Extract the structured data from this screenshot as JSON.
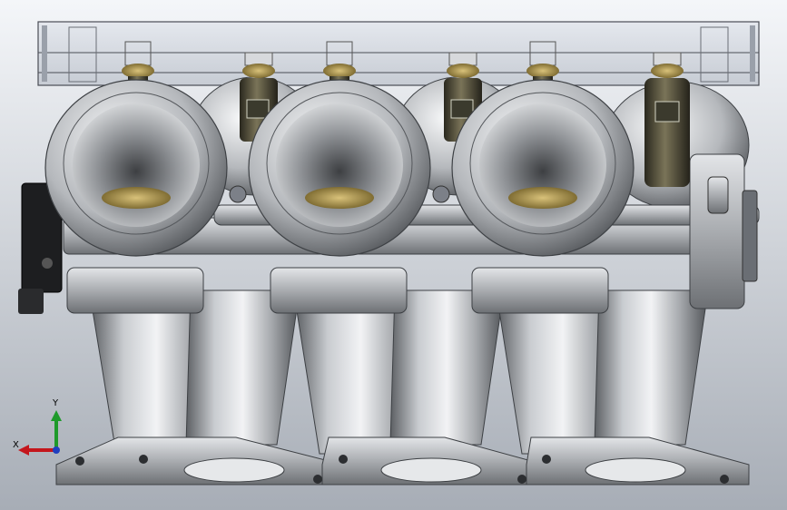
{
  "viewport": {
    "background_top": "#f4f6f9",
    "background_bottom": "#a7adb6"
  },
  "model": {
    "part": "intake-manifold-assembly",
    "runner_count": 6,
    "throttle_body_count": 3,
    "injector_count": 6,
    "metal_color": "#b9bcc0",
    "injector_body_color": "#54503d",
    "brass_color": "#8d7a3a"
  },
  "triad": {
    "x_label": "X",
    "y_label": "Y",
    "x_color": "#c4161c",
    "y_color": "#1e9a2a",
    "z_color": "#1f3fbf"
  }
}
